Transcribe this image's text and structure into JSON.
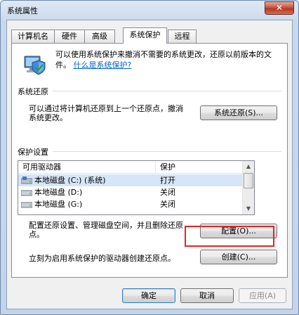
{
  "window": {
    "title": "系统属性",
    "close_glyph": "✕"
  },
  "tabs": [
    {
      "label": "计算机名"
    },
    {
      "label": "硬件"
    },
    {
      "label": "高级"
    },
    {
      "label": "系统保护",
      "active": true
    },
    {
      "label": "远程"
    }
  ],
  "intro": {
    "text": "可以使用系统保护来撤消不需要的系统更改，还原以前版本的文件。",
    "link": "什么是系统保护?",
    "icon": "shield-computer-icon"
  },
  "restore_group": {
    "title": "系统还原",
    "description": "可以通过将计算机还原到上一个还原点，撤消系统更改。",
    "button": "系统还原(S)..."
  },
  "protection_group": {
    "title": "保护设置",
    "columns": [
      "可用驱动器",
      "保护"
    ],
    "rows": [
      {
        "drive": "本地磁盘 (C:) (系统)",
        "protection": "打开",
        "icon": "system-disk-icon"
      },
      {
        "drive": "本地磁盘 (D:)",
        "protection": "关闭",
        "icon": "disk-icon"
      },
      {
        "drive": "本地磁盘 (G:)",
        "protection": "关闭",
        "icon": "disk-icon"
      }
    ],
    "configure_text": "配置还原设置、管理磁盘空间，并且删除还原点。",
    "configure_button": "配置(O)...",
    "create_text": "立刻为启用系统保护的驱动器创建还原点。",
    "create_button": "创建(C)..."
  },
  "footer": {
    "ok": "确定",
    "cancel": "取消",
    "apply": "应用(A)"
  },
  "colors": {
    "highlight": "#e0262a",
    "link": "#0066cc",
    "selected_row": "#d6e5f7"
  }
}
